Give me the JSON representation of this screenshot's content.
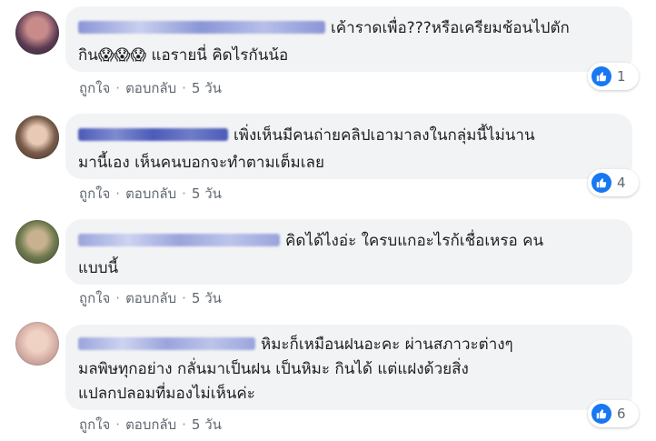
{
  "comments": [
    {
      "text": "เค้าราดเพื่อ???หรือเครียมช้อนไปตัก\nกิน😱😱😱 แอรายนี่ คิดไรกันน้อ",
      "actions": {
        "like": "ถูกใจ",
        "reply": "ตอบกลับ",
        "age": "5 วัน"
      },
      "reaction_count": "1"
    },
    {
      "text": "เพิ่งเห็นมีคนถ่ายคลิปเอามาลงในกลุ่มนี้ไม่นาน\nมานี้เอง เห็นคนบอกจะทำตามเต็มเลย",
      "actions": {
        "like": "ถูกใจ",
        "reply": "ตอบกลับ",
        "age": "5 วัน"
      },
      "reaction_count": "4"
    },
    {
      "text": "คิดได้ไงอ่ะ ใครบแกอะไรก้เชื่อเหรอ คน\nแบบนี้",
      "actions": {
        "like": "ถูกใจ",
        "reply": "ตอบกลับ",
        "age": "5 วัน"
      },
      "reaction_count": ""
    },
    {
      "text": "หิมะก็เหมือนฝนอะคะ ผ่านสภาวะต่างๆ\nมลพิษทุกอย่าง กลั่นมาเป็นฝน เป็นหิมะ กินได้ แต่แฝงด้วยสิ่ง\nแปลกปลอมที่มองไม่เห็นค่ะ",
      "actions": {
        "like": "ถูกใจ",
        "reply": "ตอบกลับ",
        "age": "5 วัน"
      },
      "reaction_count": "6"
    }
  ],
  "separator": "·",
  "colors": {
    "like_blue": "#1877f2",
    "bubble_bg": "#f2f3f5",
    "meta_text": "#606770",
    "name_blur": "#4b5bb8"
  }
}
